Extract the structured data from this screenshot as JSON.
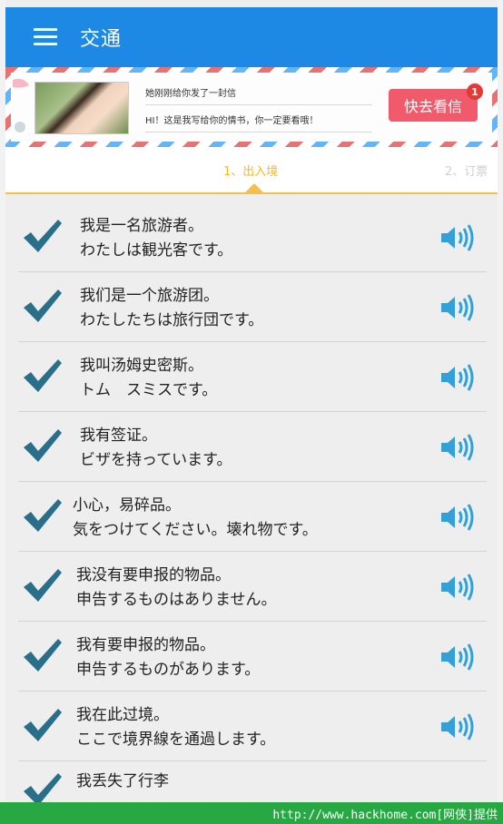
{
  "header": {
    "title": "交通"
  },
  "ad": {
    "line1": "她刚刚给你发了一封信",
    "line2": "HI！这是我写给你的情书，你一定要看哦！",
    "button": "快去看信",
    "badge": "1"
  },
  "tabs": [
    {
      "label": "1、出入境"
    },
    {
      "label": "2、订票"
    }
  ],
  "phrases": [
    {
      "zh": "我是一名旅游者。",
      "ja": "わたしは観光客です。"
    },
    {
      "zh": "我们是一个旅游团。",
      "ja": "わたしたちは旅行団です。"
    },
    {
      "zh": "我叫汤姆史密斯。",
      "ja": "トム　スミスです。"
    },
    {
      "zh": "我有签证。",
      "ja": "ビザを持っています。"
    },
    {
      "zh": "小心，易碎品。",
      "ja": "気をつけてください。壊れ物です。"
    },
    {
      "zh": "我没有要申报的物品。",
      "ja": "申告するものはありません。"
    },
    {
      "zh": "我有要申报的物品。",
      "ja": "申告するものがあります。"
    },
    {
      "zh": "我在此过境。",
      "ja": "ここで境界線を通過します。"
    },
    {
      "zh": "我丢失了行李",
      "ja": ""
    }
  ],
  "footer": {
    "text": "http://www.hackhome.com[网侠]提供"
  },
  "colors": {
    "appbar": "#1e88e5",
    "tab_accent": "#f5c04a",
    "check": "#2a6f8a",
    "speaker": "#33a0d8"
  }
}
